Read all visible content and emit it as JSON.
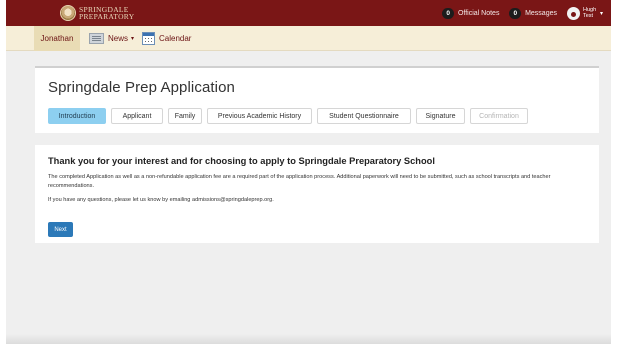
{
  "brand": {
    "logo_line1": "SPRINGDALE",
    "logo_line2": "PREPARATORY"
  },
  "header": {
    "official_notes_count": "0",
    "official_notes_label": "Official Notes",
    "messages_count": "0",
    "messages_label": "Messages",
    "user_first": "Hugh",
    "user_last": "Test",
    "user_caret": "▾"
  },
  "subnav": {
    "items": [
      {
        "label": "Jonathan",
        "icon": "",
        "active": true
      },
      {
        "label": "News",
        "icon": "news-icon",
        "caret": "▾"
      },
      {
        "label": "Calendar",
        "icon": "calendar-icon"
      }
    ]
  },
  "application": {
    "title": "Springdale Prep Application",
    "tabs": [
      {
        "label": "Introduction",
        "state": "active"
      },
      {
        "label": "Applicant",
        "state": "normal"
      },
      {
        "label": "Family",
        "state": "normal"
      },
      {
        "label": "Previous Academic History",
        "state": "normal"
      },
      {
        "label": "Student Questionnaire",
        "state": "normal"
      },
      {
        "label": "Signature",
        "state": "normal"
      },
      {
        "label": "Confirmation",
        "state": "disabled"
      }
    ]
  },
  "intro": {
    "heading": "Thank you for your interest and for choosing to apply to Springdale Preparatory School",
    "paragraph1": "The completed Application as well as a non-refundable application fee are a required part of the application process. Additional paperwork will need to be submitted, such as school transcripts and teacher recommendations.",
    "paragraph2": "If you have any questions, please let us know by emailing admissions@springdaleprep.org.",
    "next_label": "Next"
  },
  "colors": {
    "brand": "#7a1616",
    "subnav_bg": "#f6eed8",
    "active_tab": "#8dcff0",
    "primary_button": "#2c79b8"
  }
}
